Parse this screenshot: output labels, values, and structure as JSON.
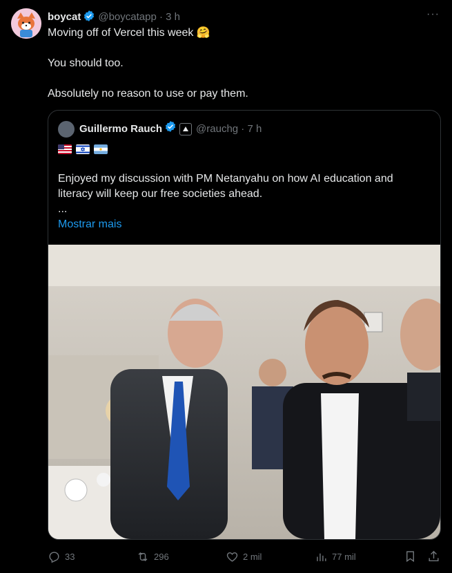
{
  "tweet": {
    "author_name": "boycat",
    "handle": "@boycatapp",
    "separator": "·",
    "time": "3 h",
    "more_label": "···",
    "lines": [
      "Moving off of Vercel this week 🤗",
      "You should too.",
      "Absolutely no reason to use or pay them."
    ]
  },
  "quote": {
    "author_name": "Guillermo Rauch",
    "handle": "@rauchg",
    "separator": "·",
    "time": "7 h",
    "flags": [
      "us-flag",
      "israel-flag",
      "argentina-flag"
    ],
    "text": "Enjoyed my discussion with PM Netanyahu on how AI education and literacy will keep our free societies ahead.",
    "ellipsis": "...",
    "show_more": "Mostrar mais"
  },
  "actions": {
    "replies": "33",
    "reposts": "296",
    "likes": "2 mil",
    "views": "77 mil"
  },
  "colors": {
    "background": "#000000",
    "text": "#e7e9ea",
    "muted": "#71767b",
    "accent": "#1d9bf0",
    "border": "#2f3336"
  }
}
